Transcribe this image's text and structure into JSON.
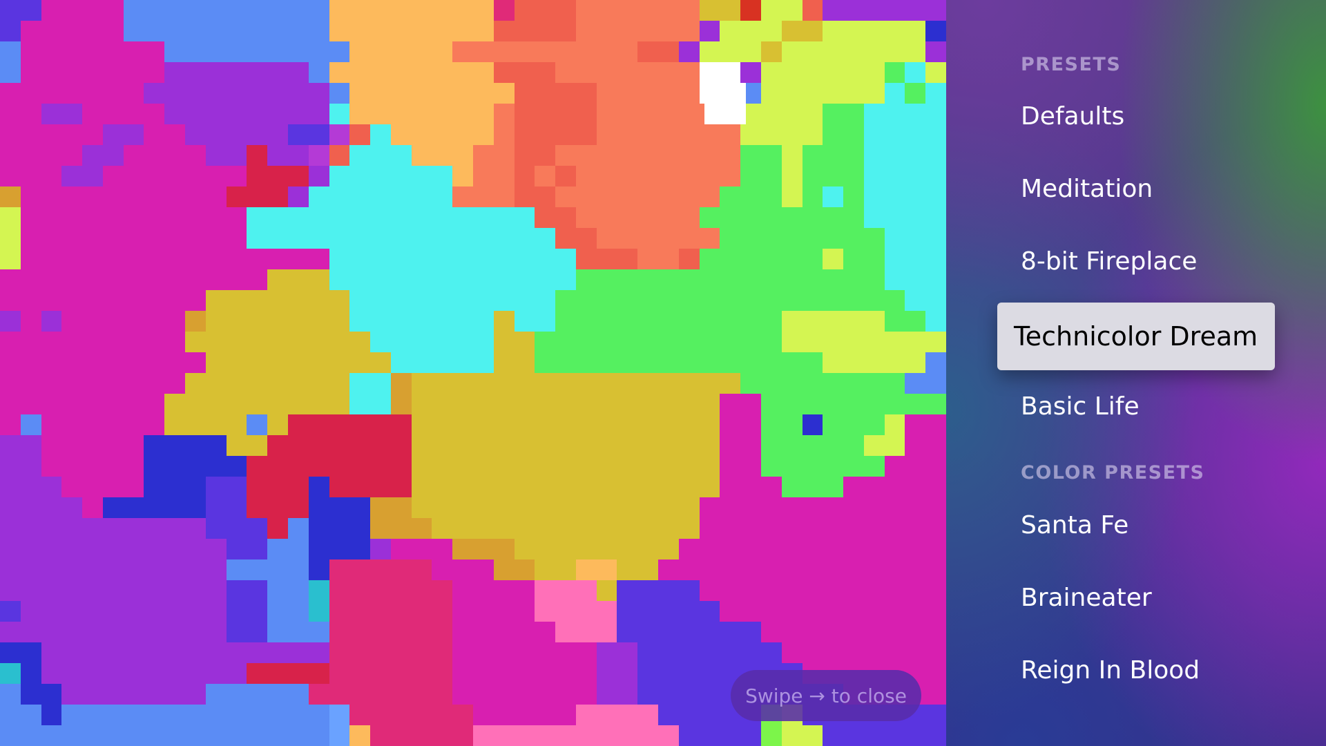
{
  "canvas": {
    "palette": {
      "M": "#d81fb0",
      "m": "#e040c8",
      "P": "#9b30d8",
      "p": "#b43ad6",
      "V": "#5a35e0",
      "v": "#7a45e8",
      "B": "#5b8cf5",
      "b": "#6aa2ff",
      "D": "#2c2fd0",
      "O": "#fdba5c",
      "o": "#f5a070",
      "S": "#f87a5a",
      "R": "#f0604e",
      "r": "#d8224a",
      "K": "#e02a78",
      "C": "#4ef2ef",
      "c": "#5fe8d6",
      "G": "#55f060",
      "g": "#7cf54a",
      "L": "#d4f552",
      "l": "#c8f04a",
      "Y": "#d8c032",
      "y": "#cfb423",
      "A": "#d8a030",
      "U": "#d83222",
      "W": "#ffffff",
      "I": "#ff70b8",
      "T": "#2abfcf"
    },
    "rows": [
      "VVMMMMBBBBBBBBBBOOOOOOOOKRRRSSSSSSYYULLRPPPPPP",
      "VMMMMMBBBBBBBBBBOOOOOOOORRRRSSSSSSPLLLYYLLLLLD",
      "BMMMMMMMBBBBBBBBBOOOOOSSSSSSSSSRRPLLLYLLLLLLLP",
      "BMMMMMMMPPPPPPPBOOOOOOOORRRSSSSSSSWWPLLLLLLGCLL",
      "MMMMMMMPPPPPPPPPBOOOOOOOORRRRSSSSSWWBLLLLLLCGCG",
      "MMPPMMMMPPPPPPPPCOOOOOOOSRRRRSSSSSSOLLLLGGCCCCG",
      "MMMMMPPMMPPPPPVVpRCOOOOOSRRRRSSSSSSSLLLLGGCCCCG",
      "MMMMPPMMMMPPrPPpRCCCOOOSSRRSSSSSSSSSGGLGGGCCCCG",
      "MMMPPMMMMMMMrrrPCCCCCCOSSRSRSSSSSSSSGGLGGGCCCCG",
      "AMMMMMMMMMMrrrPCCCCCCCSSSRRSSSSSSSSGGGLGCGCCCCG",
      "LMMMMMMMMMMMCCCCCCCCCCCCCCRRSSSSSSGGGGGGGGCCCCG",
      "LMMMMMMMMMMMCCCCCCCCCCCCCCCRRSSSSSSGGGGGGGGCCCCG",
      "LMMMMMMMMMMMMMMMCCCCCCCCCCCCRRRSSRGGGGGGLGGCCCCG",
      "MMMMMMMMMMMMMYYYCCCCCCCCCCCCGGGGGGGGGGGGGGGCCCCG",
      "MMMMMMMMMMYYYYYYYCCCCCCCCCCGGGGGGGGGGGGGGGGGCCCV",
      "PMPMMMMMMAYYYYYYYCCCCCCCYCCGGGGGGGGGGGLLLLLGGCCV",
      "MMMMMMMMMYYYYYYYYYCCCCCCYYGGGGGGGGGGGGLLLLLLLLBV",
      "MMMMMMMMMMYYYYYYYYYCCCCCYYGGGGGGGGGGGGGGLLLLLBBV",
      "MMMMMMMMMYYYYYYYYCCAYYYYYYYYYYYYYYYYGGGGGGGGBBVV",
      "MMMMMMMMYYYYYYYYYCCAYYYYYYYYYYYYYYYMMGGGGGGGGGGV",
      "MBMMMMMMYYYYBYrrrrrrYYYYYYYYYYYYYYYMMGGDGGGLMMPP",
      "PPMMMMMDDDDYYrrrrrrrYYYYYYYYYYYYYYYMMGGGGGLLMMPP",
      "PPMMMMMDDDDDrrrrrrrrYYYYYYYYYYYYYYYMMGGGGGGMMMPP",
      "PPPMMMMDDDVVrrrDrrrrYYYYYYYYYYYYYYYMMMGGGMMMMMPP",
      "PPPPMDDDDDVVrrrDDDAAYYYYYYYYYYYYYYMMMMMMMMMMMMBB",
      "PPPPPPPPPPVVVrBDDDAAAYYYYYYYYYYYYYMMMMMMMMMMMMBB",
      "PPPPPPPPPPPVVBBDDDPMMMAAAYYYYYYYYMMMMMMMMMMMMMPP",
      "PPPPPPPPPPPBBBBDKKKKKMMMAAYYOOYYMMMMMMMMMMMMMMPP",
      "PPPPPPPPPPPVVBBTKKKKKKMMMMIIIYVVVVMMMMMMMMMMMMMM",
      "VPPPPPPPPPPVVBBTKKKKKKMMMMIIIIVVVVVMMMMMMMMMMMMM",
      "PPPPPPPPPPPVVBBBKKKKKKMMMMMIIIVVVVVVVMMMMMMMMMMM",
      "DDPPPPPPPPPPPPPPKKKKKKMMMMMMMPPVVVVVVVMMMMMMMMMM",
      "TDPPPPPPPPPPrrrrKKKKKKMMMMMMMPPVVVVVVVVMMMMMMMMM",
      "BDDPPPPPPPBBBBBKKKKKKKMMMMMMMPPVVVVVVVVVVMMMMMMM",
      "BBDBBBBBBBBBBBBBbKKKKKKMMMMMIIIIVVVVVgLVVVVVVVVV",
      "BBBBBBBBBBBBBBBBbOKKKKKIIIIIIIIIIVVVVgLLVVVVVVVV"
    ]
  },
  "hint": {
    "text": "Swipe → to close"
  },
  "sidebar": {
    "presets_header": "PRESETS",
    "presets": [
      "Defaults",
      "Meditation",
      "8-bit Fireplace",
      "Technicolor Dream",
      "Basic Life"
    ],
    "selected_preset": "Technicolor Dream",
    "color_presets_header": "COLOR PRESETS",
    "color_presets": [
      "Santa Fe",
      "Braineater",
      "Reign In Blood"
    ]
  }
}
